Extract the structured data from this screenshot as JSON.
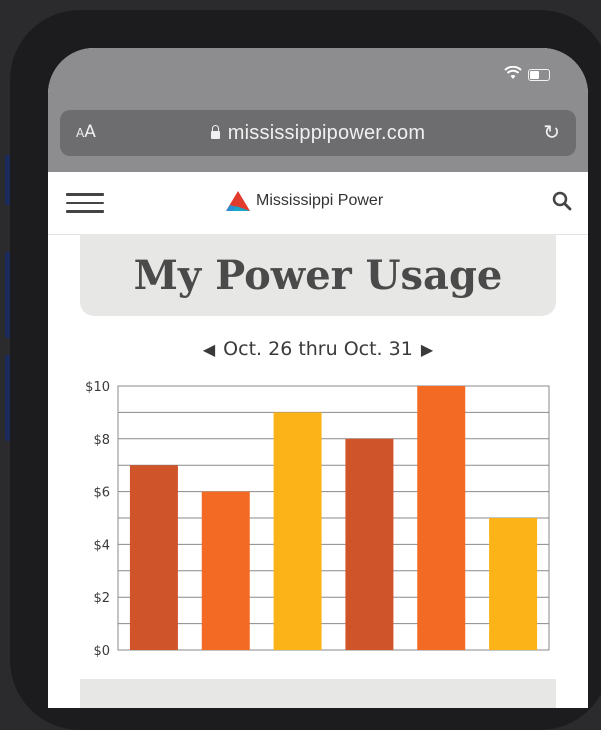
{
  "browser": {
    "url": "mississippipower.com",
    "text_size_label": "AA"
  },
  "site": {
    "brand_name": "Mississippi Power"
  },
  "page": {
    "title": "My Power Usage",
    "date_range": "Oct. 26 thru Oct. 31"
  },
  "colors": {
    "dark_orange": "#d0542a",
    "orange": "#f26a24",
    "yellow": "#fbb318"
  },
  "chart_data": {
    "type": "bar",
    "categories": [
      "",
      "",
      "",
      "",
      "",
      ""
    ],
    "values": [
      7,
      6,
      9,
      8,
      10,
      5
    ],
    "bar_colors": [
      "#d0542a",
      "#f26a24",
      "#fbb318",
      "#d0542a",
      "#f26a24",
      "#fbb318"
    ],
    "ylim": [
      0,
      10
    ],
    "yticks": [
      "$0",
      "$2",
      "$4",
      "$6",
      "$8",
      "$10"
    ],
    "grid": true,
    "title": "",
    "xlabel": "",
    "ylabel": ""
  }
}
